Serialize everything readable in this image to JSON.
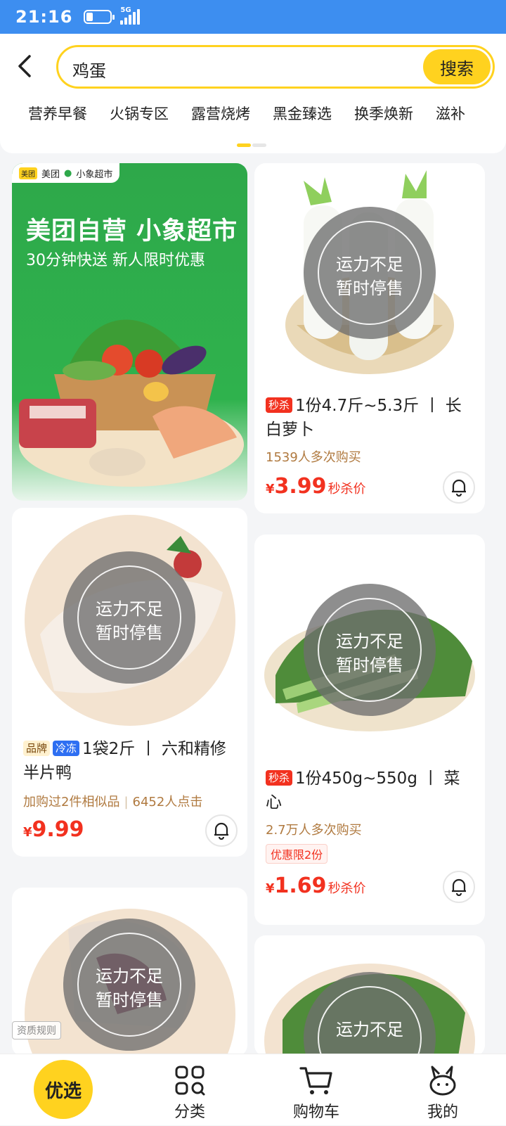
{
  "status_bar": {
    "time": "21:16",
    "network": "5G"
  },
  "search": {
    "query": "鸡蛋",
    "button_label": "搜索"
  },
  "categories": [
    "营养早餐",
    "火锅专区",
    "露营烧烤",
    "黑金臻选",
    "换季焕新",
    "滋补"
  ],
  "banner": {
    "brand": "美团",
    "sub_brand": "小象超市",
    "headline": "美团自营 小象超市",
    "subline": "30分钟快送 新人限时优惠"
  },
  "overlay": {
    "line1": "运力不足",
    "line2": "暂时停售"
  },
  "products": [
    {
      "tags": [
        "秒杀"
      ],
      "title": "1份4.7斤~5.3斤 丨 长白萝卜",
      "sub": "1539人多次购买",
      "currency": "¥",
      "price": "3.99",
      "price_label": "秒杀价"
    },
    {
      "tags": [
        "品牌",
        "冷冻"
      ],
      "title": "1袋2斤 丨 六和精修半片鸭",
      "sub": "加购过2件相似品",
      "sub2": "6452人点击",
      "currency": "¥",
      "price": "9.99",
      "price_label": ""
    },
    {
      "tags": [
        "秒杀"
      ],
      "title": "1份450g~550g 丨 菜心",
      "sub": "2.7万人多次购买",
      "limit": "优惠限2份",
      "currency": "¥",
      "price": "1.69",
      "price_label": "秒杀价"
    }
  ],
  "qualification": "资质规则",
  "tabbar": {
    "home": "优选",
    "category": "分类",
    "cart": "购物车",
    "mine": "我的"
  },
  "colors": {
    "accent": "#ffd21f",
    "price_red": "#f2311f",
    "status_blue": "#3d8ef0",
    "banner_green": "#2ea84a"
  }
}
